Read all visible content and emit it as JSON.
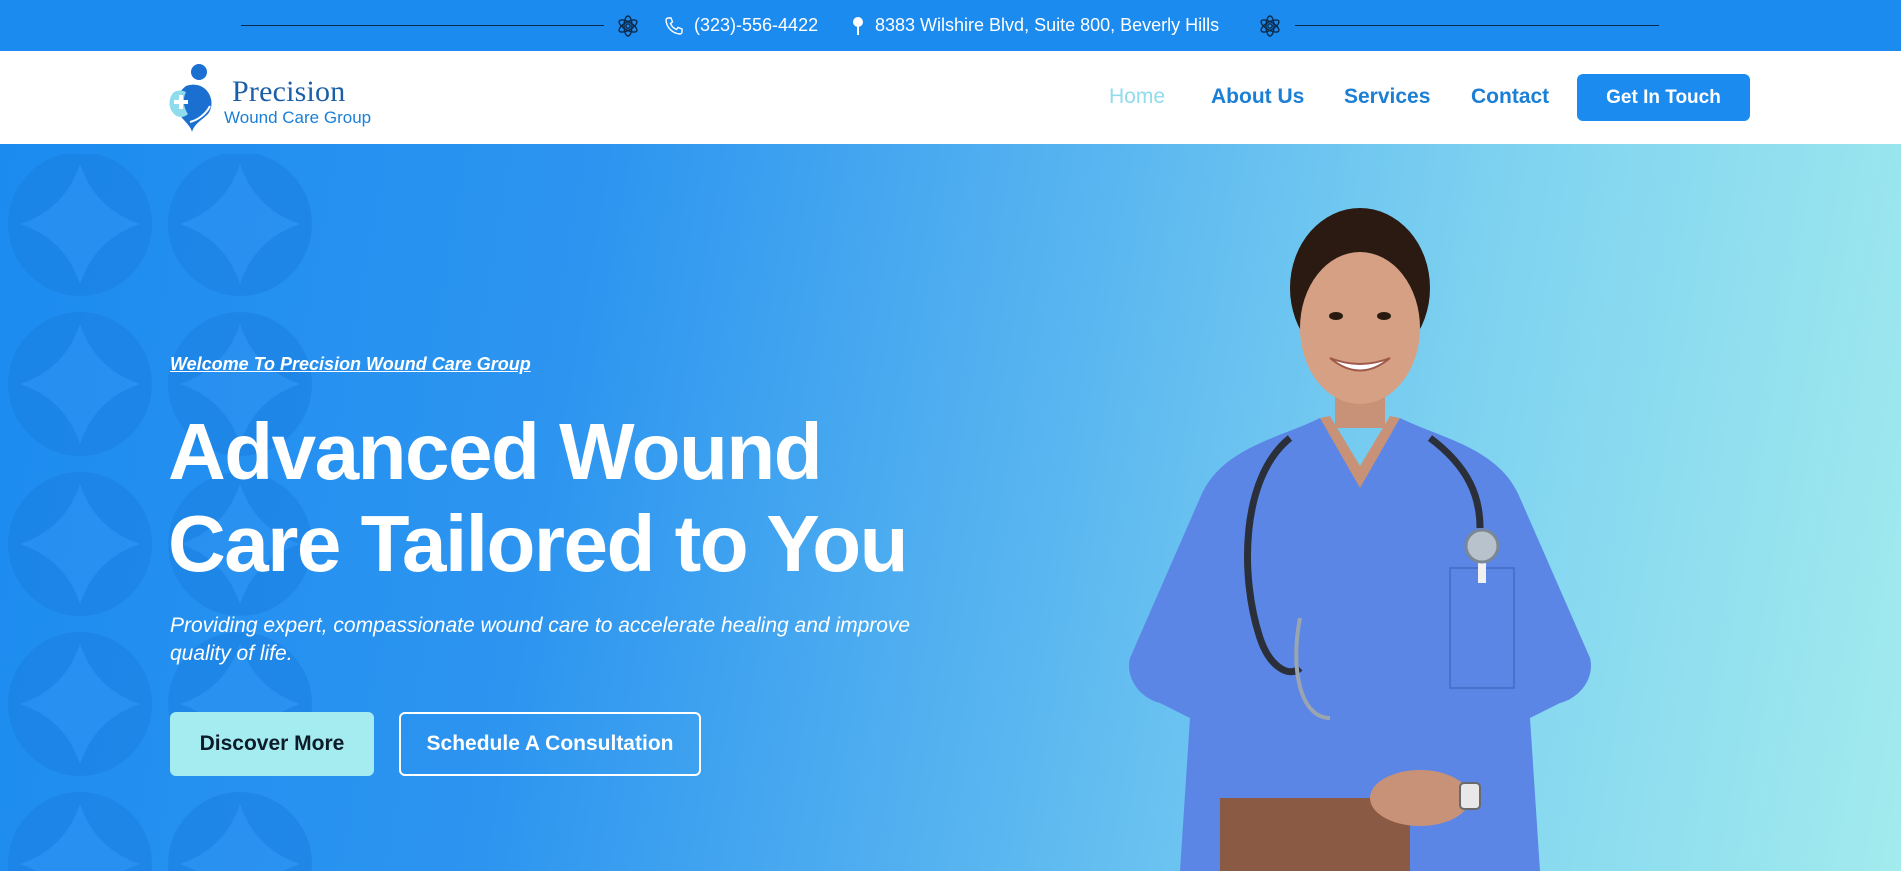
{
  "topbar": {
    "phone": "(323)-556-4422",
    "address": "8383 Wilshire Blvd, Suite 800, Beverly Hills",
    "phone_icon": "phone-icon",
    "address_icon": "location-pin-icon",
    "decor_icon": "flower-icon"
  },
  "logo": {
    "title": "Precision",
    "subtitle": "Wound Care Group"
  },
  "nav": {
    "items": [
      {
        "label": "Home",
        "active": true
      },
      {
        "label": "About Us",
        "active": false
      },
      {
        "label": "Services",
        "active": false
      },
      {
        "label": "Contact",
        "active": false
      }
    ],
    "cta_label": "Get In Touch"
  },
  "hero": {
    "welcome": "Welcome To Precision Wound Care Group",
    "headline_line1": "Advanced Wound",
    "headline_line2": "Care Tailored to You",
    "subtext": "Providing expert, compassionate wound care to accelerate healing and improve quality of life.",
    "primary_button": "Discover More",
    "secondary_button": "Schedule A Consultation",
    "image": "nurse-in-blue-scrubs-with-stethoscope"
  },
  "colors": {
    "brand_blue": "#1b8bf0",
    "nav_text": "#1b7fd6",
    "nav_active": "#8fdcec",
    "accent_aqua": "#a4ecf0",
    "scrubs": "#5b86e6"
  }
}
